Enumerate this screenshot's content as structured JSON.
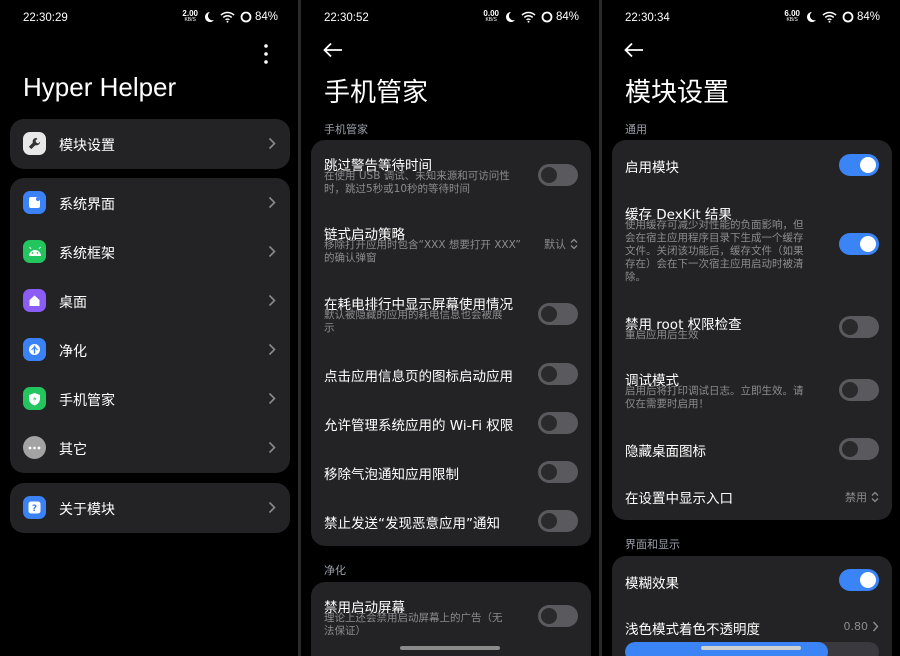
{
  "status_bars": [
    {
      "time": "22:30:29",
      "net_value": "2.00",
      "net_unit": "KB/S",
      "battery": "84%"
    },
    {
      "time": "22:30:52",
      "net_value": "0.00",
      "net_unit": "KB/S",
      "battery": "84%"
    },
    {
      "time": "22:30:34",
      "net_value": "6.00",
      "net_unit": "KB/S",
      "battery": "84%"
    }
  ],
  "screen1": {
    "title": "Hyper Helper",
    "items": {
      "module_settings": "模块设置",
      "system_ui": "系统界面",
      "system_framework": "系统框架",
      "desktop": "桌面",
      "purify": "净化",
      "security": "手机管家",
      "others": "其它",
      "about": "关于模块"
    },
    "colors": {
      "module_settings": "#ffffff",
      "system_ui": "#3b82f6",
      "system_framework": "#22c55e",
      "desktop": "#8b5cf6",
      "purify": "#3b82f6",
      "security": "#22c55e",
      "others": "#a3a3a3",
      "about": "#3b82f6"
    }
  },
  "screen2": {
    "title": "手机管家",
    "section1": "手机管家",
    "rows": {
      "skip_warning_title": "跳过警告等待时间",
      "skip_warning_sub1": "在使用 USB 调试、未知来源和可访问性",
      "skip_warning_sub2": "时，跳过5秒或10秒的等待时间",
      "chain_title": "链式启动策略",
      "chain_sub1": "移除打开应用时包含“XXX 想要打开 XXX”",
      "chain_sub2": "的确认弹窗",
      "chain_value": "默认",
      "battery_title": "在耗电排行中显示屏幕使用情况",
      "battery_sub1": "默认被隐藏的应用的耗电信息也会被展",
      "battery_sub2": "示",
      "icon_launch_title": "点击应用信息页的图标启动应用",
      "wifi_title": "允许管理系统应用的 Wi-Fi 权限",
      "bubble_title": "移除气泡通知应用限制",
      "malware_title": "禁止发送“发现恶意应用”通知"
    },
    "section2": "净化",
    "splash_title": "禁用启动屏幕",
    "splash_sub1": "理论上还会禁用启动屏幕上的广告（无",
    "splash_sub2": "法保证）"
  },
  "screen3": {
    "title": "模块设置",
    "section1": "通用",
    "rows": {
      "enable_module": "启用模块",
      "cache_title": "缓存 DexKit 结果",
      "cache_sub1": "使用缓存可减少对性能的负面影响，但",
      "cache_sub2": "会在宿主应用程序目录下生成一个缓存",
      "cache_sub3": "文件。关闭该功能后，缓存文件（如果",
      "cache_sub4": "存在）会在下一次宿主应用启动时被清",
      "cache_sub5": "除。",
      "root_title": "禁用 root 权限检查",
      "root_sub": "重启应用后生效",
      "debug_title": "调试模式",
      "debug_sub1": "启用后将打印调试日志。立即生效。请",
      "debug_sub2": "仅在需要时启用！",
      "hide_icon": "隐藏桌面图标",
      "show_entry": "在设置中显示入口",
      "show_entry_value": "禁用"
    },
    "section2": "界面和显示",
    "blur": "模糊效果",
    "opacity_title": "浅色模式着色不透明度",
    "opacity_value": "0.80",
    "opacity_fraction": 0.8
  },
  "toggles": {
    "s2_skip_warning": false,
    "s2_battery": false,
    "s2_icon_launch": false,
    "s2_wifi": false,
    "s2_bubble": false,
    "s2_malware": false,
    "s2_splash": false,
    "s3_enable_module": true,
    "s3_cache": true,
    "s3_root": false,
    "s3_debug": false,
    "s3_hide_icon": false,
    "s3_blur": true
  }
}
